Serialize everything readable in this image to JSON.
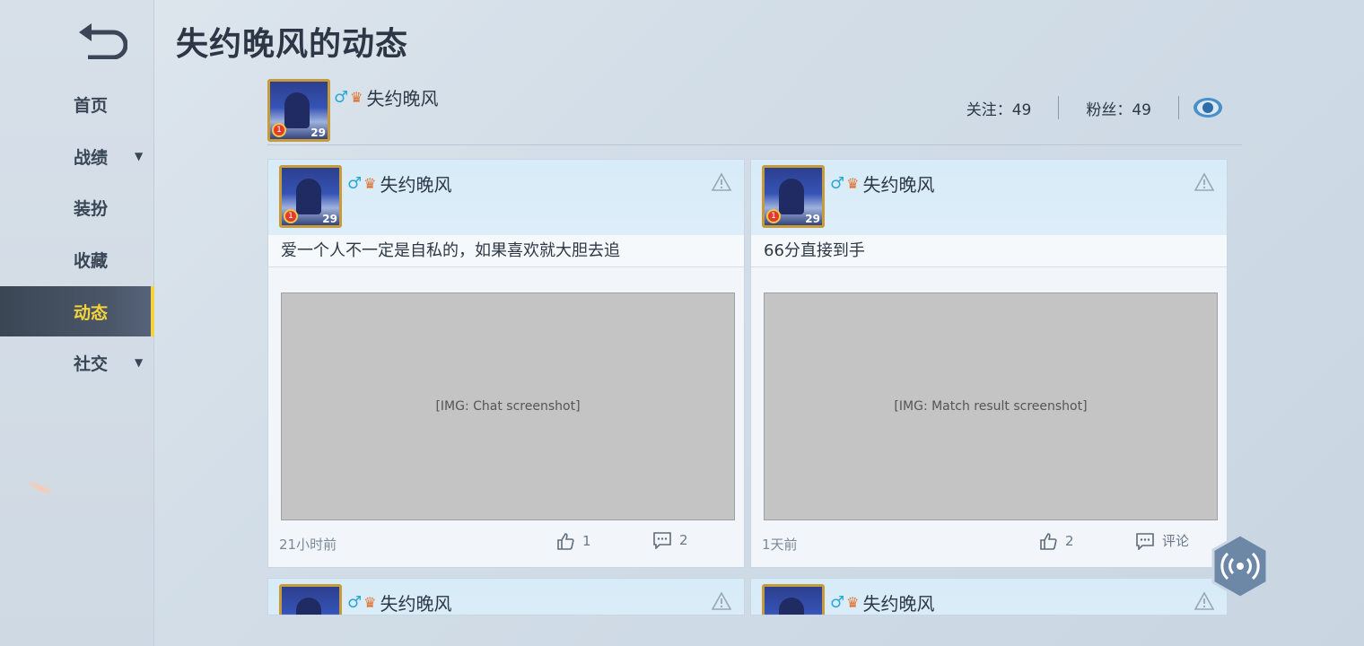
{
  "page_title": "失约晚风的动态",
  "sidebar": {
    "items": [
      {
        "label": "首页",
        "has_caret": false
      },
      {
        "label": "战绩",
        "has_caret": true
      },
      {
        "label": "装扮",
        "has_caret": false
      },
      {
        "label": "收藏",
        "has_caret": false
      },
      {
        "label": "动态",
        "has_caret": false,
        "active": true
      },
      {
        "label": "社交",
        "has_caret": true
      }
    ]
  },
  "profile": {
    "username": "失约晚风",
    "level": "29",
    "rank": "1",
    "follow_label": "关注：49",
    "fans_label": "粉丝：49"
  },
  "posts": [
    {
      "username": "失约晚风",
      "level": "29",
      "rank": "1",
      "text": "爱一个人不一定是自私的，如果喜欢就大胆去追",
      "image_desc": "friend chat screenshot",
      "time": "21小时前",
      "likes": "1",
      "comments": "2"
    },
    {
      "username": "失约晚风",
      "level": "29",
      "rank": "1",
      "text": "66分直接到手",
      "image_desc": "match result screenshot",
      "time": "1天前",
      "likes": "2",
      "comments": "评论"
    },
    {
      "username": "失约晚风",
      "level": "29",
      "rank": "1"
    },
    {
      "username": "失约晚风",
      "level": "29",
      "rank": "1"
    }
  ],
  "colors": {
    "accent": "#f5d33a",
    "sidebar_active": "#3b4655"
  }
}
